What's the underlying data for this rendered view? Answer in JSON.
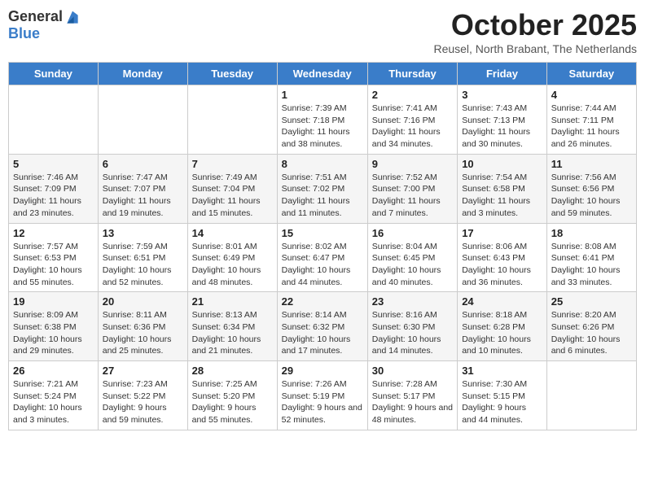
{
  "logo": {
    "general": "General",
    "blue": "Blue"
  },
  "header": {
    "month": "October 2025",
    "location": "Reusel, North Brabant, The Netherlands"
  },
  "weekdays": [
    "Sunday",
    "Monday",
    "Tuesday",
    "Wednesday",
    "Thursday",
    "Friday",
    "Saturday"
  ],
  "weeks": [
    [
      {
        "day": "",
        "info": ""
      },
      {
        "day": "",
        "info": ""
      },
      {
        "day": "",
        "info": ""
      },
      {
        "day": "1",
        "info": "Sunrise: 7:39 AM\nSunset: 7:18 PM\nDaylight: 11 hours\nand 38 minutes."
      },
      {
        "day": "2",
        "info": "Sunrise: 7:41 AM\nSunset: 7:16 PM\nDaylight: 11 hours\nand 34 minutes."
      },
      {
        "day": "3",
        "info": "Sunrise: 7:43 AM\nSunset: 7:13 PM\nDaylight: 11 hours\nand 30 minutes."
      },
      {
        "day": "4",
        "info": "Sunrise: 7:44 AM\nSunset: 7:11 PM\nDaylight: 11 hours\nand 26 minutes."
      }
    ],
    [
      {
        "day": "5",
        "info": "Sunrise: 7:46 AM\nSunset: 7:09 PM\nDaylight: 11 hours\nand 23 minutes."
      },
      {
        "day": "6",
        "info": "Sunrise: 7:47 AM\nSunset: 7:07 PM\nDaylight: 11 hours\nand 19 minutes."
      },
      {
        "day": "7",
        "info": "Sunrise: 7:49 AM\nSunset: 7:04 PM\nDaylight: 11 hours\nand 15 minutes."
      },
      {
        "day": "8",
        "info": "Sunrise: 7:51 AM\nSunset: 7:02 PM\nDaylight: 11 hours\nand 11 minutes."
      },
      {
        "day": "9",
        "info": "Sunrise: 7:52 AM\nSunset: 7:00 PM\nDaylight: 11 hours\nand 7 minutes."
      },
      {
        "day": "10",
        "info": "Sunrise: 7:54 AM\nSunset: 6:58 PM\nDaylight: 11 hours\nand 3 minutes."
      },
      {
        "day": "11",
        "info": "Sunrise: 7:56 AM\nSunset: 6:56 PM\nDaylight: 10 hours\nand 59 minutes."
      }
    ],
    [
      {
        "day": "12",
        "info": "Sunrise: 7:57 AM\nSunset: 6:53 PM\nDaylight: 10 hours\nand 55 minutes."
      },
      {
        "day": "13",
        "info": "Sunrise: 7:59 AM\nSunset: 6:51 PM\nDaylight: 10 hours\nand 52 minutes."
      },
      {
        "day": "14",
        "info": "Sunrise: 8:01 AM\nSunset: 6:49 PM\nDaylight: 10 hours\nand 48 minutes."
      },
      {
        "day": "15",
        "info": "Sunrise: 8:02 AM\nSunset: 6:47 PM\nDaylight: 10 hours\nand 44 minutes."
      },
      {
        "day": "16",
        "info": "Sunrise: 8:04 AM\nSunset: 6:45 PM\nDaylight: 10 hours\nand 40 minutes."
      },
      {
        "day": "17",
        "info": "Sunrise: 8:06 AM\nSunset: 6:43 PM\nDaylight: 10 hours\nand 36 minutes."
      },
      {
        "day": "18",
        "info": "Sunrise: 8:08 AM\nSunset: 6:41 PM\nDaylight: 10 hours\nand 33 minutes."
      }
    ],
    [
      {
        "day": "19",
        "info": "Sunrise: 8:09 AM\nSunset: 6:38 PM\nDaylight: 10 hours\nand 29 minutes."
      },
      {
        "day": "20",
        "info": "Sunrise: 8:11 AM\nSunset: 6:36 PM\nDaylight: 10 hours\nand 25 minutes."
      },
      {
        "day": "21",
        "info": "Sunrise: 8:13 AM\nSunset: 6:34 PM\nDaylight: 10 hours\nand 21 minutes."
      },
      {
        "day": "22",
        "info": "Sunrise: 8:14 AM\nSunset: 6:32 PM\nDaylight: 10 hours\nand 17 minutes."
      },
      {
        "day": "23",
        "info": "Sunrise: 8:16 AM\nSunset: 6:30 PM\nDaylight: 10 hours\nand 14 minutes."
      },
      {
        "day": "24",
        "info": "Sunrise: 8:18 AM\nSunset: 6:28 PM\nDaylight: 10 hours\nand 10 minutes."
      },
      {
        "day": "25",
        "info": "Sunrise: 8:20 AM\nSunset: 6:26 PM\nDaylight: 10 hours\nand 6 minutes."
      }
    ],
    [
      {
        "day": "26",
        "info": "Sunrise: 7:21 AM\nSunset: 5:24 PM\nDaylight: 10 hours\nand 3 minutes."
      },
      {
        "day": "27",
        "info": "Sunrise: 7:23 AM\nSunset: 5:22 PM\nDaylight: 9 hours\nand 59 minutes."
      },
      {
        "day": "28",
        "info": "Sunrise: 7:25 AM\nSunset: 5:20 PM\nDaylight: 9 hours\nand 55 minutes."
      },
      {
        "day": "29",
        "info": "Sunrise: 7:26 AM\nSunset: 5:19 PM\nDaylight: 9 hours\nand 52 minutes."
      },
      {
        "day": "30",
        "info": "Sunrise: 7:28 AM\nSunset: 5:17 PM\nDaylight: 9 hours\nand 48 minutes."
      },
      {
        "day": "31",
        "info": "Sunrise: 7:30 AM\nSunset: 5:15 PM\nDaylight: 9 hours\nand 44 minutes."
      },
      {
        "day": "",
        "info": ""
      }
    ]
  ]
}
